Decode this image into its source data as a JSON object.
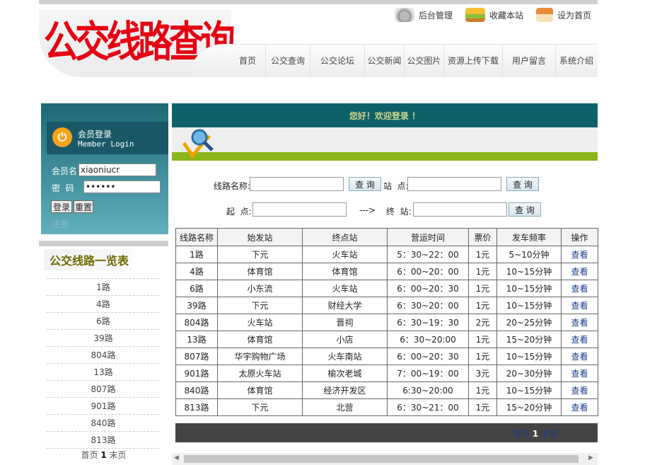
{
  "header": {
    "logo_text": "公交线路查询",
    "top_links": [
      {
        "label": "后台管理",
        "icon": "phone-icon"
      },
      {
        "label": "收藏本站",
        "icon": "bookmark-icon"
      },
      {
        "label": "设为首页",
        "icon": "home-icon"
      }
    ],
    "nav": [
      "首页",
      "公交查询",
      "公交论坛",
      "公交新闻",
      "公交图片",
      "资源上传下载",
      "用户留言",
      "系统介绍"
    ]
  },
  "login": {
    "title": "会员登录",
    "subtitle": "Member Login",
    "username_label": "会员名",
    "username_value": "xiaoniucr",
    "password_label": "密  码",
    "password_value": "••••••",
    "login_button": "登录",
    "reset_button": "重置",
    "register_link": "注册"
  },
  "route_list": {
    "title": "公交线路一览表",
    "items": [
      "1路",
      "4路",
      "6路",
      "39路",
      "804路",
      "13路",
      "807路",
      "901路",
      "840路",
      "813路"
    ],
    "pager_first": "首页",
    "pager_current": "1",
    "pager_last": "末页"
  },
  "main": {
    "welcome": "您好！欢迎登录 ！",
    "search": {
      "line_label": "线路名称:",
      "query_button": "查 询",
      "station_label": "站  点:",
      "start_label": "起  点:",
      "arrow": "--->",
      "end_label": "终  站:"
    },
    "table": {
      "headers": [
        "线路名称",
        "始发站",
        "终点站",
        "营运时间",
        "票价",
        "发车频率",
        "操作"
      ],
      "rows": [
        [
          "1路",
          "下元",
          "火车站",
          "5：30~22：00",
          "1元",
          "5~10分钟",
          "查看"
        ],
        [
          "4路",
          "体育馆",
          "体育馆",
          "6：00~20：00",
          "1元",
          "10~15分钟",
          "查看"
        ],
        [
          "6路",
          "小东流",
          "火车站",
          "6：00~20：30",
          "1元",
          "10~15分钟",
          "查看"
        ],
        [
          "39路",
          "下元",
          "财经大学",
          "6：30~20：00",
          "1元",
          "10~15分钟",
          "查看"
        ],
        [
          "804路",
          "火车站",
          "晋祠",
          "6：30~19：30",
          "2元",
          "20~25分钟",
          "查看"
        ],
        [
          "13路",
          "体育馆",
          "小店",
          "6：30~20:00",
          "1元",
          "15~20分钟",
          "查看"
        ],
        [
          "807路",
          "华宇购物广场",
          "火车南站",
          "6：00~20：30",
          "1元",
          "10~15分钟",
          "查看"
        ],
        [
          "901路",
          "太原火车站",
          "榆次老城",
          "7：00~19：00",
          "3元",
          "20~30分钟",
          "查看"
        ],
        [
          "840路",
          "体育馆",
          "经济开发区",
          "6:30~20:00",
          "1元",
          "10~15分钟",
          "查看"
        ],
        [
          "813路",
          "下元",
          "北营",
          "6：30~21：00",
          "1元",
          "15~20分钟",
          "查看"
        ]
      ]
    },
    "pager_first": "首页",
    "pager_current": "1",
    "pager_last": "末页"
  }
}
